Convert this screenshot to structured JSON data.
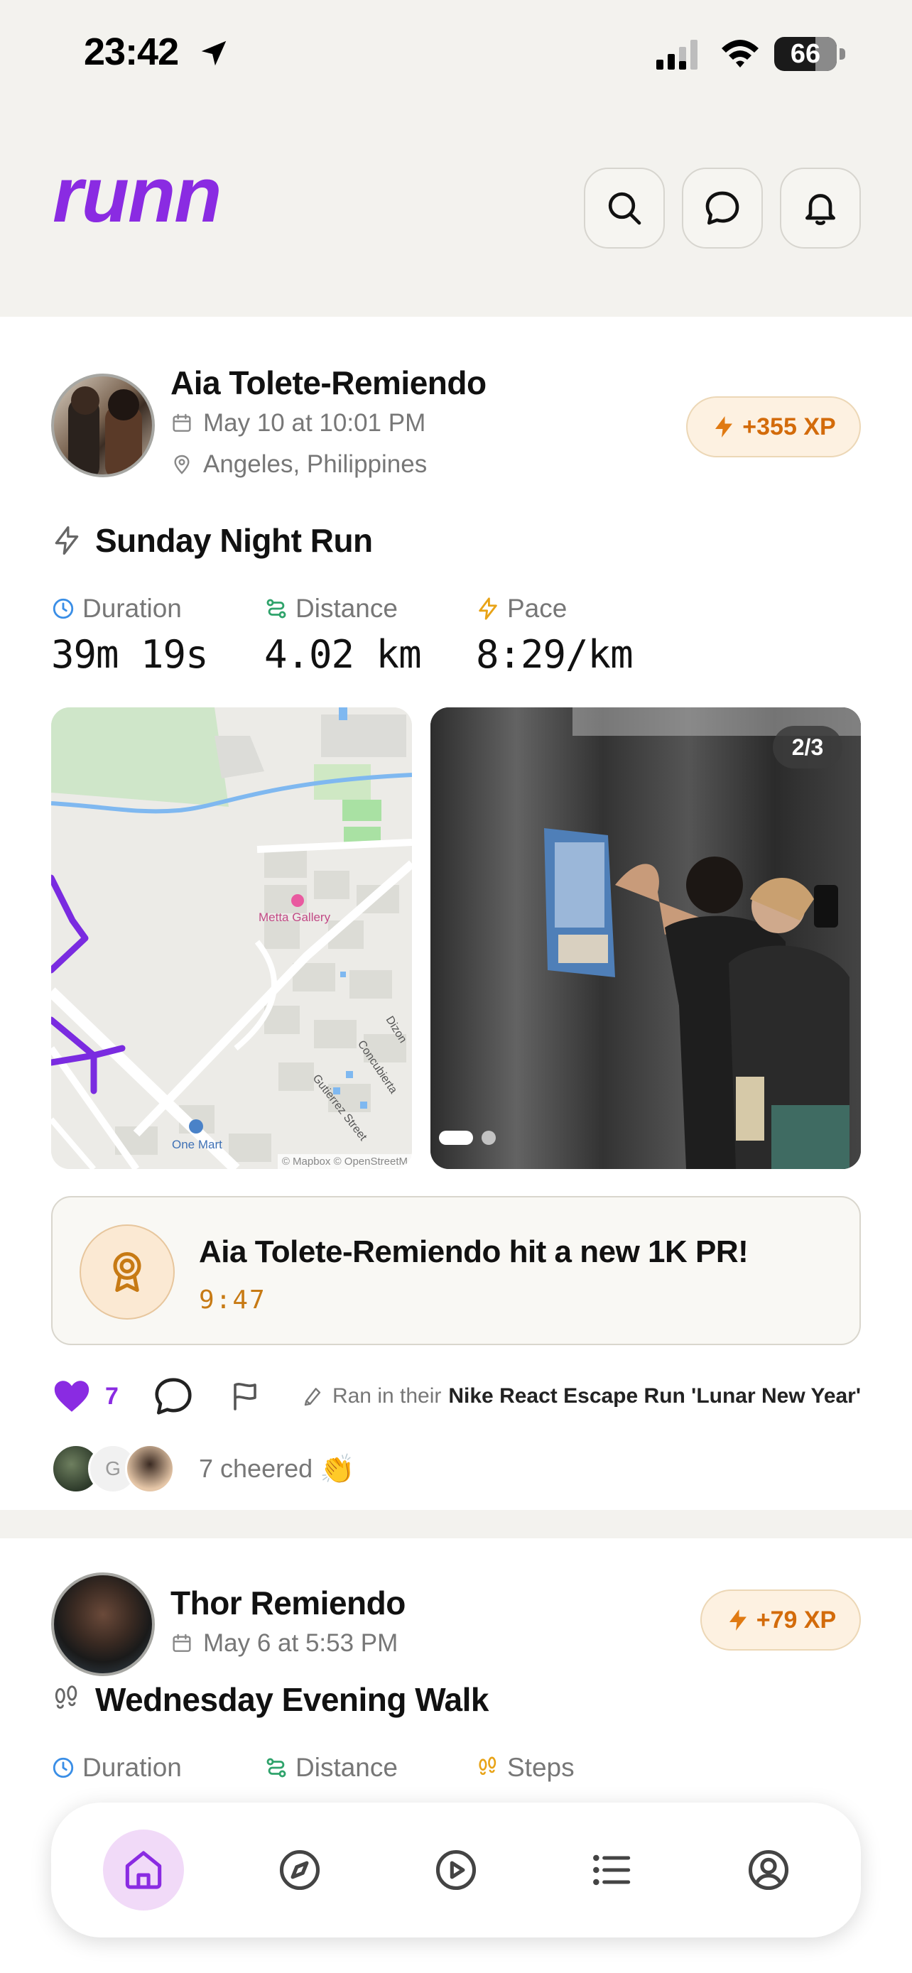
{
  "status_bar": {
    "time": "23:42",
    "battery": "66"
  },
  "header": {
    "logo": "runn",
    "buttons": [
      {
        "icon": "search-icon"
      },
      {
        "icon": "chat-bubble-icon"
      },
      {
        "icon": "bell-icon"
      }
    ]
  },
  "posts": [
    {
      "user_name": "Aia Tolete-Remiendo",
      "date": "May 10 at 10:01 PM",
      "location": "Angeles, Philippines",
      "xp": "+355 XP",
      "activity_title": "Sunday Night Run",
      "activity_icon": "lightning-icon",
      "stats": [
        {
          "label": "Duration",
          "value": "39m 19s",
          "icon": "clock-icon"
        },
        {
          "label": "Distance",
          "value": "4.02 km",
          "icon": "route-icon"
        },
        {
          "label": "Pace",
          "value": "8:29/km",
          "icon": "lightning-icon"
        }
      ],
      "map": {
        "place_labels": [
          "Metta Gallery",
          "One Mart",
          "Gutierrez Street",
          "Concubierta",
          "Dizon"
        ],
        "attribution": "© Mapbox © OpenStreetM"
      },
      "photo": {
        "counter": "2/3",
        "page_dots": 2,
        "active_dot": 0
      },
      "pr": {
        "title": "Aia Tolete-Remiendo hit a new 1K PR!",
        "time": "9:47"
      },
      "likes": "7",
      "shoe_prefix": "Ran in their",
      "shoe_name": "Nike React Escape Run 'Lunar New Year'",
      "cheer_avatar_initial": "G",
      "cheered": "7 cheered",
      "cheer_emoji": "👏"
    },
    {
      "user_name": "Thor Remiendo",
      "date": "May 6 at 5:53 PM",
      "xp": "+79 XP",
      "activity_title": "Wednesday Evening Walk",
      "activity_icon": "footprints-icon",
      "stats": [
        {
          "label": "Duration",
          "icon": "clock-icon"
        },
        {
          "label": "Distance",
          "icon": "route-icon"
        },
        {
          "label": "Steps",
          "icon": "footprints-icon"
        }
      ]
    }
  ],
  "bottom_nav": [
    {
      "icon": "home-icon",
      "active": true
    },
    {
      "icon": "compass-icon",
      "active": false
    },
    {
      "icon": "play-circle-icon",
      "active": false
    },
    {
      "icon": "list-icon",
      "active": false
    },
    {
      "icon": "profile-icon",
      "active": false
    }
  ],
  "colors": {
    "brand": "#8a2be2",
    "xp_text": "#d36b0a",
    "pr_time": "#c77a14",
    "clock_icon": "#3a8ee6",
    "route_icon": "#2fa36b",
    "pace_icon": "#e8a317",
    "steps_icon": "#e8a317"
  }
}
